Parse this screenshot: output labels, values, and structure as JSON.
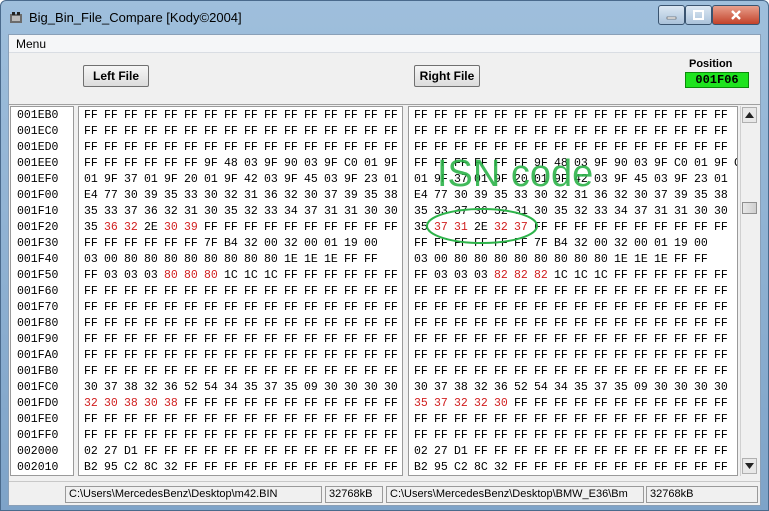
{
  "window": {
    "title": "Big_Bin_File_Compare [Kody©2004]"
  },
  "menu": {
    "menu_label": "Menu"
  },
  "toolbar": {
    "left_file_label": "Left File",
    "right_file_label": "Right File",
    "position_label": "Position",
    "position_value": "001F06"
  },
  "colors": {
    "position_bg": "#1ee31e",
    "diff_text": "#d02020",
    "annotation": "#2db34a"
  },
  "annotation": {
    "text": "ISN code"
  },
  "addresses": [
    "001EB0",
    "001EC0",
    "001ED0",
    "001EE0",
    "001EF0",
    "001F00",
    "001F10",
    "001F20",
    "001F30",
    "001F40",
    "001F50",
    "001F60",
    "001F70",
    "001F80",
    "001F90",
    "001FA0",
    "001FB0",
    "001FC0",
    "001FD0",
    "001FE0",
    "001FF0",
    "002000",
    "002010"
  ],
  "left_rows": [
    [
      "FF",
      "FF",
      "FF",
      "FF",
      "FF",
      "FF",
      "FF",
      "FF",
      "FF",
      "FF",
      "FF",
      "FF",
      "FF",
      "FF",
      "FF",
      "FF"
    ],
    [
      "FF",
      "FF",
      "FF",
      "FF",
      "FF",
      "FF",
      "FF",
      "FF",
      "FF",
      "FF",
      "FF",
      "FF",
      "FF",
      "FF",
      "FF",
      "FF"
    ],
    [
      "FF",
      "FF",
      "FF",
      "FF",
      "FF",
      "FF",
      "FF",
      "FF",
      "FF",
      "FF",
      "FF",
      "FF",
      "FF",
      "FF",
      "FF",
      "FF"
    ],
    [
      "FF",
      "FF",
      "FF",
      "FF",
      "FF",
      "FF",
      "9F",
      "48",
      "03",
      "9F",
      "90",
      "03",
      "9F",
      "C0",
      "01",
      "9F",
      "C3"
    ],
    [
      "01",
      "9F",
      "37",
      "01",
      "9F",
      "20",
      "01",
      "9F",
      "42",
      "03",
      "9F",
      "45",
      "03",
      "9F",
      "23",
      "01"
    ],
    [
      "E4",
      "77",
      "30",
      "39",
      "35",
      "33",
      "30",
      "32",
      "31",
      "36",
      "32",
      "30",
      "37",
      "39",
      "35",
      "38"
    ],
    [
      "35",
      "33",
      "37",
      "36",
      "32",
      "31",
      "30",
      "35",
      "32",
      "33",
      "34",
      "37",
      "31",
      "31",
      "30",
      "30"
    ],
    [
      "35",
      "36",
      "32",
      "2E",
      "30",
      "39",
      "FF",
      "FF",
      "FF",
      "FF",
      "FF",
      "FF",
      "FF",
      "FF",
      "FF",
      "FF"
    ],
    [
      "FF",
      "FF",
      "FF",
      "FF",
      "FF",
      "FF",
      "7F",
      "B4",
      "32",
      "00",
      "32",
      "00",
      "01",
      "19",
      "00"
    ],
    [
      "03",
      "00",
      "80",
      "80",
      "80",
      "80",
      "80",
      "80",
      "80",
      "80",
      "1E",
      "1E",
      "1E",
      "FF",
      "FF"
    ],
    [
      "FF",
      "03",
      "03",
      "03",
      "80",
      "80",
      "80",
      "1C",
      "1C",
      "1C",
      "FF",
      "FF",
      "FF",
      "FF",
      "FF",
      "FF"
    ],
    [
      "FF",
      "FF",
      "FF",
      "FF",
      "FF",
      "FF",
      "FF",
      "FF",
      "FF",
      "FF",
      "FF",
      "FF",
      "FF",
      "FF",
      "FF",
      "FF"
    ],
    [
      "FF",
      "FF",
      "FF",
      "FF",
      "FF",
      "FF",
      "FF",
      "FF",
      "FF",
      "FF",
      "FF",
      "FF",
      "FF",
      "FF",
      "FF",
      "FF"
    ],
    [
      "FF",
      "FF",
      "FF",
      "FF",
      "FF",
      "FF",
      "FF",
      "FF",
      "FF",
      "FF",
      "FF",
      "FF",
      "FF",
      "FF",
      "FF",
      "FF"
    ],
    [
      "FF",
      "FF",
      "FF",
      "FF",
      "FF",
      "FF",
      "FF",
      "FF",
      "FF",
      "FF",
      "FF",
      "FF",
      "FF",
      "FF",
      "FF",
      "FF"
    ],
    [
      "FF",
      "FF",
      "FF",
      "FF",
      "FF",
      "FF",
      "FF",
      "FF",
      "FF",
      "FF",
      "FF",
      "FF",
      "FF",
      "FF",
      "FF",
      "FF"
    ],
    [
      "FF",
      "FF",
      "FF",
      "FF",
      "FF",
      "FF",
      "FF",
      "FF",
      "FF",
      "FF",
      "FF",
      "FF",
      "FF",
      "FF",
      "FF",
      "FF"
    ],
    [
      "30",
      "37",
      "38",
      "32",
      "36",
      "52",
      "54",
      "34",
      "35",
      "37",
      "35",
      "09",
      "30",
      "30",
      "30",
      "30"
    ],
    [
      "32",
      "30",
      "38",
      "30",
      "38",
      "FF",
      "FF",
      "FF",
      "FF",
      "FF",
      "FF",
      "FF",
      "FF",
      "FF",
      "FF",
      "FF"
    ],
    [
      "FF",
      "FF",
      "FF",
      "FF",
      "FF",
      "FF",
      "FF",
      "FF",
      "FF",
      "FF",
      "FF",
      "FF",
      "FF",
      "FF",
      "FF",
      "FF"
    ],
    [
      "FF",
      "FF",
      "FF",
      "FF",
      "FF",
      "FF",
      "FF",
      "FF",
      "FF",
      "FF",
      "FF",
      "FF",
      "FF",
      "FF",
      "FF",
      "FF"
    ],
    [
      "02",
      "27",
      "D1",
      "FF",
      "FF",
      "FF",
      "FF",
      "FF",
      "FF",
      "FF",
      "FF",
      "FF",
      "FF",
      "FF",
      "FF",
      "FF"
    ],
    [
      "B2",
      "95",
      "C2",
      "8C",
      "32",
      "FF",
      "FF",
      "FF",
      "FF",
      "FF",
      "FF",
      "FF",
      "FF",
      "FF",
      "FF",
      "FF"
    ]
  ],
  "left_diff": [
    [],
    [],
    [],
    [],
    [],
    [],
    [],
    [
      1,
      2,
      4,
      5
    ],
    [],
    [],
    [
      4,
      5,
      6
    ],
    [],
    [],
    [],
    [],
    [],
    [],
    [],
    [
      0,
      1,
      2,
      3,
      4
    ],
    [],
    [],
    [],
    []
  ],
  "right_rows": [
    [
      "FF",
      "FF",
      "FF",
      "FF",
      "FF",
      "FF",
      "FF",
      "FF",
      "FF",
      "FF",
      "FF",
      "FF",
      "FF",
      "FF",
      "FF",
      "FF"
    ],
    [
      "FF",
      "FF",
      "FF",
      "FF",
      "FF",
      "FF",
      "FF",
      "FF",
      "FF",
      "FF",
      "FF",
      "FF",
      "FF",
      "FF",
      "FF",
      "FF"
    ],
    [
      "FF",
      "FF",
      "FF",
      "FF",
      "FF",
      "FF",
      "FF",
      "FF",
      "FF",
      "FF",
      "FF",
      "FF",
      "FF",
      "FF",
      "FF",
      "FF"
    ],
    [
      "FF",
      "FF",
      "FF",
      "FF",
      "FF",
      "FF",
      "9F",
      "48",
      "03",
      "9F",
      "90",
      "03",
      "9F",
      "C0",
      "01",
      "9F",
      "C3"
    ],
    [
      "01",
      "9F",
      "37",
      "01",
      "9F",
      "20",
      "01",
      "9F",
      "42",
      "03",
      "9F",
      "45",
      "03",
      "9F",
      "23",
      "01"
    ],
    [
      "E4",
      "77",
      "30",
      "39",
      "35",
      "33",
      "30",
      "32",
      "31",
      "36",
      "32",
      "30",
      "37",
      "39",
      "35",
      "38"
    ],
    [
      "35",
      "33",
      "37",
      "36",
      "32",
      "31",
      "30",
      "35",
      "32",
      "33",
      "34",
      "37",
      "31",
      "31",
      "30",
      "30"
    ],
    [
      "35",
      "37",
      "31",
      "2E",
      "32",
      "37",
      "FF",
      "FF",
      "FF",
      "FF",
      "FF",
      "FF",
      "FF",
      "FF",
      "FF",
      "FF"
    ],
    [
      "FF",
      "FF",
      "FF",
      "FF",
      "FF",
      "FF",
      "7F",
      "B4",
      "32",
      "00",
      "32",
      "00",
      "01",
      "19",
      "00"
    ],
    [
      "03",
      "00",
      "80",
      "80",
      "80",
      "80",
      "80",
      "80",
      "80",
      "80",
      "1E",
      "1E",
      "1E",
      "FF",
      "FF"
    ],
    [
      "FF",
      "03",
      "03",
      "03",
      "82",
      "82",
      "82",
      "1C",
      "1C",
      "1C",
      "FF",
      "FF",
      "FF",
      "FF",
      "FF",
      "FF"
    ],
    [
      "FF",
      "FF",
      "FF",
      "FF",
      "FF",
      "FF",
      "FF",
      "FF",
      "FF",
      "FF",
      "FF",
      "FF",
      "FF",
      "FF",
      "FF",
      "FF"
    ],
    [
      "FF",
      "FF",
      "FF",
      "FF",
      "FF",
      "FF",
      "FF",
      "FF",
      "FF",
      "FF",
      "FF",
      "FF",
      "FF",
      "FF",
      "FF",
      "FF"
    ],
    [
      "FF",
      "FF",
      "FF",
      "FF",
      "FF",
      "FF",
      "FF",
      "FF",
      "FF",
      "FF",
      "FF",
      "FF",
      "FF",
      "FF",
      "FF",
      "FF"
    ],
    [
      "FF",
      "FF",
      "FF",
      "FF",
      "FF",
      "FF",
      "FF",
      "FF",
      "FF",
      "FF",
      "FF",
      "FF",
      "FF",
      "FF",
      "FF",
      "FF"
    ],
    [
      "FF",
      "FF",
      "FF",
      "FF",
      "FF",
      "FF",
      "FF",
      "FF",
      "FF",
      "FF",
      "FF",
      "FF",
      "FF",
      "FF",
      "FF",
      "FF"
    ],
    [
      "FF",
      "FF",
      "FF",
      "FF",
      "FF",
      "FF",
      "FF",
      "FF",
      "FF",
      "FF",
      "FF",
      "FF",
      "FF",
      "FF",
      "FF",
      "FF"
    ],
    [
      "30",
      "37",
      "38",
      "32",
      "36",
      "52",
      "54",
      "34",
      "35",
      "37",
      "35",
      "09",
      "30",
      "30",
      "30",
      "30"
    ],
    [
      "35",
      "37",
      "32",
      "32",
      "30",
      "FF",
      "FF",
      "FF",
      "FF",
      "FF",
      "FF",
      "FF",
      "FF",
      "FF",
      "FF",
      "FF"
    ],
    [
      "FF",
      "FF",
      "FF",
      "FF",
      "FF",
      "FF",
      "FF",
      "FF",
      "FF",
      "FF",
      "FF",
      "FF",
      "FF",
      "FF",
      "FF",
      "FF"
    ],
    [
      "FF",
      "FF",
      "FF",
      "FF",
      "FF",
      "FF",
      "FF",
      "FF",
      "FF",
      "FF",
      "FF",
      "FF",
      "FF",
      "FF",
      "FF",
      "FF"
    ],
    [
      "02",
      "27",
      "D1",
      "FF",
      "FF",
      "FF",
      "FF",
      "FF",
      "FF",
      "FF",
      "FF",
      "FF",
      "FF",
      "FF",
      "FF",
      "FF"
    ],
    [
      "B2",
      "95",
      "C2",
      "8C",
      "32",
      "FF",
      "FF",
      "FF",
      "FF",
      "FF",
      "FF",
      "FF",
      "FF",
      "FF",
      "FF",
      "FF"
    ]
  ],
  "right_diff": [
    [],
    [],
    [],
    [],
    [],
    [],
    [],
    [
      1,
      2,
      4,
      5
    ],
    [],
    [],
    [
      4,
      5,
      6
    ],
    [],
    [],
    [],
    [],
    [],
    [],
    [],
    [
      0,
      1,
      2,
      3,
      4
    ],
    [],
    [],
    [],
    []
  ],
  "status": {
    "left_path": "C:\\Users\\MercedesBenz\\Desktop\\m42.BIN",
    "left_size": "32768kB",
    "right_path": "C:\\Users\\MercedesBenz\\Desktop\\BMW_E36\\Bm",
    "right_size": "32768kB"
  }
}
